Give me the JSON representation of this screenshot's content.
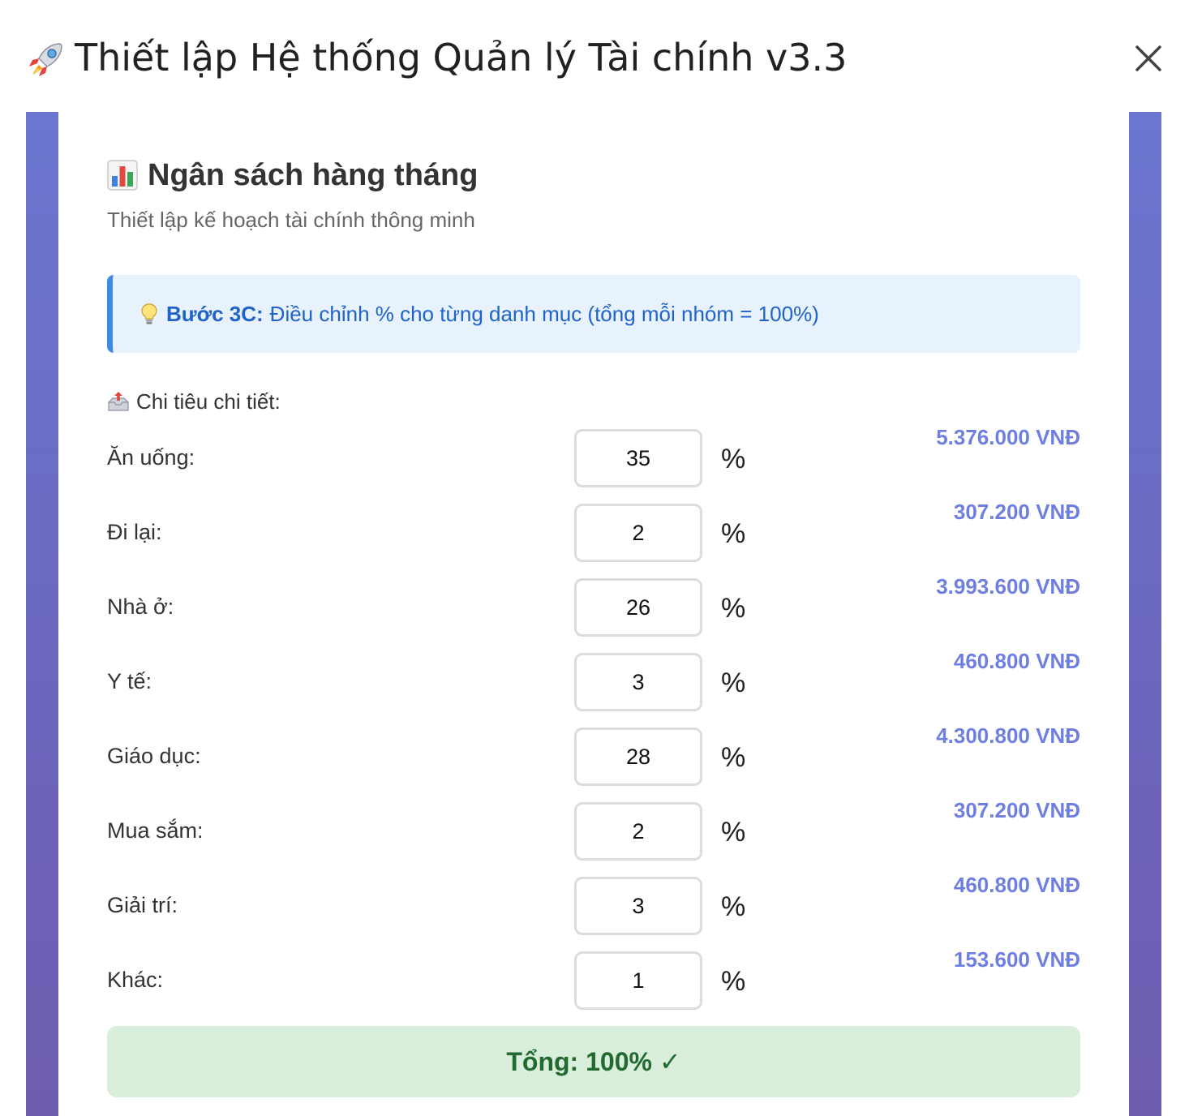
{
  "dialog": {
    "title": "Thiết lập Hệ thống Quản lý Tài chính v3.3",
    "title_icon": "rocket-icon",
    "close_label": "×"
  },
  "panel": {
    "heading": "Ngân sách hàng tháng",
    "heading_icon": "bar-chart-icon",
    "subtitle": "Thiết lập kế hoạch tài chính thông minh"
  },
  "info": {
    "icon": "lightbulb-icon",
    "strong": "Bước 3C:",
    "text": "Điều chỉnh % cho từng danh mục (tổng mỗi nhóm = 100%)"
  },
  "section": {
    "icon": "outbox-tray-icon",
    "label": "Chi tiêu chi tiết:"
  },
  "categories": [
    {
      "label": "Ăn uống:",
      "percent": "35",
      "unit": "%",
      "amount": "5.376.000 VNĐ"
    },
    {
      "label": "Đi lại:",
      "percent": "2",
      "unit": "%",
      "amount": "307.200 VNĐ"
    },
    {
      "label": "Nhà ở:",
      "percent": "26",
      "unit": "%",
      "amount": "3.993.600 VNĐ"
    },
    {
      "label": "Y tế:",
      "percent": "3",
      "unit": "%",
      "amount": "460.800 VNĐ"
    },
    {
      "label": "Giáo dục:",
      "percent": "28",
      "unit": "%",
      "amount": "4.300.800 VNĐ"
    },
    {
      "label": "Mua sắm:",
      "percent": "2",
      "unit": "%",
      "amount": "307.200 VNĐ"
    },
    {
      "label": "Giải trí:",
      "percent": "3",
      "unit": "%",
      "amount": "460.800 VNĐ"
    },
    {
      "label": "Khác:",
      "percent": "1",
      "unit": "%",
      "amount": "153.600 VNĐ"
    }
  ],
  "total": {
    "text": "Tổng: 100% ✓"
  },
  "colors": {
    "frame_top": "#6a76d0",
    "frame_bottom": "#6e5caf",
    "info_bg": "#e7f2fc",
    "info_accent": "#3d8be5",
    "amount": "#6f7fe0",
    "total_bg": "#d9eedb",
    "total_text": "#236a30"
  }
}
